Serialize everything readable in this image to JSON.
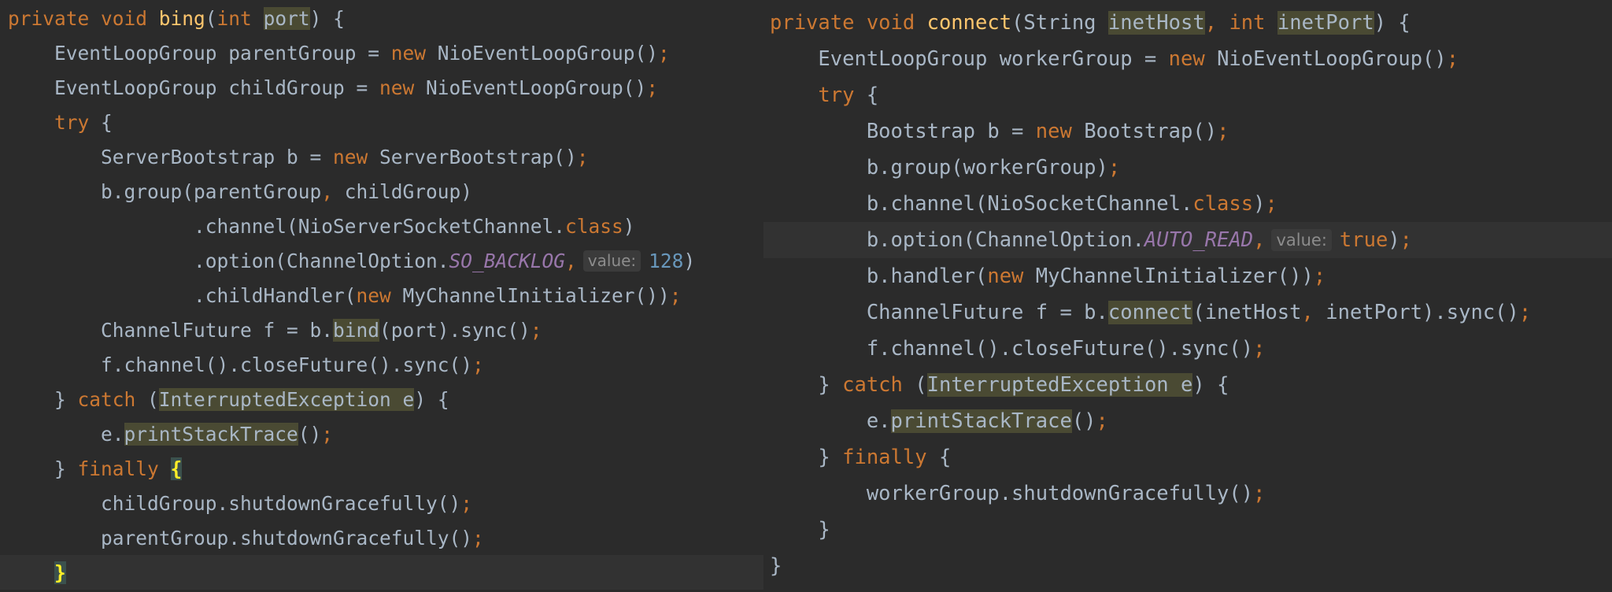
{
  "panes": [
    {
      "id": "left",
      "lines": [
        {
          "tokens": [
            {
              "t": "private void ",
              "c": "k"
            },
            {
              "t": "bing",
              "c": "fn"
            },
            {
              "t": "("
            },
            {
              "t": "int ",
              "c": "k"
            },
            {
              "t": "port",
              "c": "hl"
            },
            {
              "t": ") {"
            }
          ]
        },
        {
          "tokens": [
            {
              "t": "    EventLoopGroup parentGroup = "
            },
            {
              "t": "new ",
              "c": "k"
            },
            {
              "t": "NioEventLoopGroup()"
            },
            {
              "t": ";",
              "c": "k"
            }
          ]
        },
        {
          "tokens": [
            {
              "t": "    EventLoopGroup childGroup = "
            },
            {
              "t": "new ",
              "c": "k"
            },
            {
              "t": "NioEventLoopGroup()"
            },
            {
              "t": ";",
              "c": "k"
            }
          ]
        },
        {
          "tokens": [
            {
              "t": "    "
            },
            {
              "t": "try ",
              "c": "k"
            },
            {
              "t": "{"
            }
          ]
        },
        {
          "tokens": [
            {
              "t": "        ServerBootstrap b = "
            },
            {
              "t": "new ",
              "c": "k"
            },
            {
              "t": "ServerBootstrap()"
            },
            {
              "t": ";",
              "c": "k"
            }
          ]
        },
        {
          "tokens": [
            {
              "t": "        b.group(parentGroup"
            },
            {
              "t": ", ",
              "c": "k"
            },
            {
              "t": "childGroup)"
            }
          ]
        },
        {
          "tokens": [
            {
              "t": "                .channel(NioServerSocketChannel."
            },
            {
              "t": "class",
              "c": "k"
            },
            {
              "t": ")"
            }
          ]
        },
        {
          "tokens": [
            {
              "t": "                .option(ChannelOption."
            },
            {
              "t": "SO_BACKLOG",
              "c": "fld"
            },
            {
              "t": ",",
              "c": "k"
            },
            {
              "t": "value:",
              "c": "hint"
            },
            {
              "t": "128",
              "c": "num"
            },
            {
              "t": ")"
            }
          ]
        },
        {
          "tokens": [
            {
              "t": "                .childHandler("
            },
            {
              "t": "new ",
              "c": "k"
            },
            {
              "t": "MyChannelInitializer())"
            },
            {
              "t": ";",
              "c": "k"
            }
          ]
        },
        {
          "tokens": [
            {
              "t": "        ChannelFuture f = b."
            },
            {
              "t": "bind",
              "c": "hl"
            },
            {
              "t": "(port).sync()"
            },
            {
              "t": ";",
              "c": "k"
            }
          ]
        },
        {
          "tokens": [
            {
              "t": "        f.channel().closeFuture().sync()"
            },
            {
              "t": ";",
              "c": "k"
            }
          ]
        },
        {
          "tokens": [
            {
              "t": "    } "
            },
            {
              "t": "catch ",
              "c": "k"
            },
            {
              "t": "("
            },
            {
              "t": "InterruptedException e",
              "c": "hl"
            },
            {
              "t": ") {"
            }
          ]
        },
        {
          "tokens": [
            {
              "t": "        e."
            },
            {
              "t": "printStackTrace",
              "c": "hl"
            },
            {
              "t": "()"
            },
            {
              "t": ";",
              "c": "k"
            }
          ]
        },
        {
          "tokens": [
            {
              "t": "    } "
            },
            {
              "t": "finally ",
              "c": "k"
            },
            {
              "t": "{",
              "c": "brace-hl"
            }
          ]
        },
        {
          "tokens": [
            {
              "t": "        childGroup.shutdownGracefully()"
            },
            {
              "t": ";",
              "c": "k"
            }
          ]
        },
        {
          "tokens": [
            {
              "t": "        parentGroup.shutdownGracefully()"
            },
            {
              "t": ";",
              "c": "k"
            }
          ]
        },
        {
          "current": true,
          "tokens": [
            {
              "t": "    "
            },
            {
              "t": "}",
              "c": "brace-hl"
            }
          ]
        }
      ]
    },
    {
      "id": "right",
      "lines": [
        {
          "tokens": [
            {
              "t": "private void ",
              "c": "k"
            },
            {
              "t": "connect",
              "c": "fn"
            },
            {
              "t": "(String "
            },
            {
              "t": "inetHost",
              "c": "hl"
            },
            {
              "t": ", ",
              "c": "k"
            },
            {
              "t": "int ",
              "c": "k"
            },
            {
              "t": "inetPort",
              "c": "hl"
            },
            {
              "t": ") {"
            }
          ]
        },
        {
          "tokens": [
            {
              "t": "    EventLoopGroup workerGroup = "
            },
            {
              "t": "new ",
              "c": "k"
            },
            {
              "t": "NioEventLoopGroup()"
            },
            {
              "t": ";",
              "c": "k"
            }
          ]
        },
        {
          "tokens": [
            {
              "t": "    "
            },
            {
              "t": "try ",
              "c": "k"
            },
            {
              "t": "{"
            }
          ]
        },
        {
          "tokens": [
            {
              "t": "        Bootstrap b = "
            },
            {
              "t": "new ",
              "c": "k"
            },
            {
              "t": "Bootstrap()"
            },
            {
              "t": ";",
              "c": "k"
            }
          ]
        },
        {
          "tokens": [
            {
              "t": "        b.group(workerGroup)"
            },
            {
              "t": ";",
              "c": "k"
            }
          ]
        },
        {
          "tokens": [
            {
              "t": "        b.channel(NioSocketChannel."
            },
            {
              "t": "class",
              "c": "k"
            },
            {
              "t": ")"
            },
            {
              "t": ";",
              "c": "k"
            }
          ]
        },
        {
          "current": true,
          "tokens": [
            {
              "t": "        b.option(ChannelOption."
            },
            {
              "t": "AUTO_READ",
              "c": "fld"
            },
            {
              "t": ",",
              "c": "k"
            },
            {
              "t": "value:",
              "c": "hint"
            },
            {
              "t": "true",
              "c": "k"
            },
            {
              "t": ")"
            },
            {
              "t": ";",
              "c": "k"
            }
          ]
        },
        {
          "tokens": [
            {
              "t": "        b.handler("
            },
            {
              "t": "new ",
              "c": "k"
            },
            {
              "t": "MyChannelInitializer())"
            },
            {
              "t": ";",
              "c": "k"
            }
          ]
        },
        {
          "tokens": [
            {
              "t": "        ChannelFuture f = b."
            },
            {
              "t": "connect",
              "c": "hl"
            },
            {
              "t": "(inetHost"
            },
            {
              "t": ", ",
              "c": "k"
            },
            {
              "t": "inetPort).sync()"
            },
            {
              "t": ";",
              "c": "k"
            }
          ]
        },
        {
          "tokens": [
            {
              "t": "        f.channel().closeFuture().sync()"
            },
            {
              "t": ";",
              "c": "k"
            }
          ]
        },
        {
          "tokens": [
            {
              "t": "    } "
            },
            {
              "t": "catch ",
              "c": "k"
            },
            {
              "t": "("
            },
            {
              "t": "InterruptedException e",
              "c": "hl"
            },
            {
              "t": ") {"
            }
          ]
        },
        {
          "tokens": [
            {
              "t": "        e."
            },
            {
              "t": "printStackTrace",
              "c": "hl"
            },
            {
              "t": "()"
            },
            {
              "t": ";",
              "c": "k"
            }
          ]
        },
        {
          "tokens": [
            {
              "t": "    } "
            },
            {
              "t": "finally ",
              "c": "k"
            },
            {
              "t": "{"
            }
          ]
        },
        {
          "tokens": [
            {
              "t": "        workerGroup.shutdownGracefully()"
            },
            {
              "t": ";",
              "c": "k"
            }
          ]
        },
        {
          "tokens": [
            {
              "t": "    }"
            }
          ]
        },
        {
          "tokens": [
            {
              "t": "}"
            }
          ]
        }
      ]
    }
  ],
  "colors": {
    "background": "#2b2b2b",
    "current_line": "#323232",
    "keyword": "#cc7832",
    "method_declaration": "#ffc66d",
    "static_field": "#9876aa",
    "number": "#6897bb",
    "plain_text": "#a9b7c6",
    "usage_highlight": "#4a4a33",
    "inlay_hint_background": "#3b3b3b"
  }
}
